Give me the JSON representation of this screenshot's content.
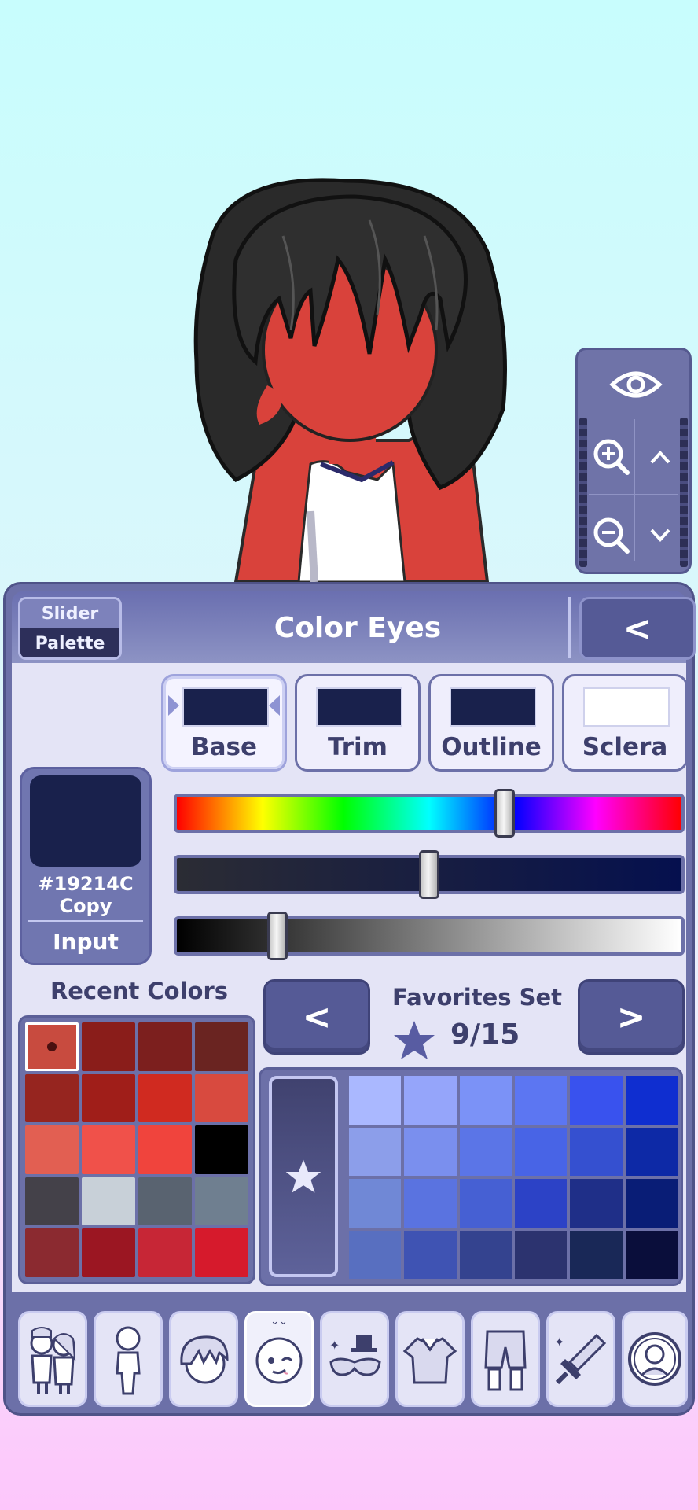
{
  "panel": {
    "title": "Color Eyes",
    "mode_toggle": {
      "slider_label": "Slider",
      "palette_label": "Palette",
      "selected": "Palette"
    },
    "back_label": "<"
  },
  "eye_parts": [
    {
      "label": "Base",
      "color": "#19214c",
      "selected": true
    },
    {
      "label": "Trim",
      "color": "#19214c",
      "selected": false
    },
    {
      "label": "Outline",
      "color": "#19214c",
      "selected": false
    },
    {
      "label": "Sclera",
      "color": "#ffffff",
      "selected": false
    }
  ],
  "current_color": {
    "hex": "#19214C",
    "copy_label": "Copy",
    "input_label": "Input"
  },
  "sliders": {
    "hue": 0.65,
    "saturation": 0.5,
    "value": 0.2
  },
  "recent_colors": {
    "title": "Recent Colors",
    "colors": [
      "#c84b3f",
      "#8a1d1a",
      "#7c1f1e",
      "#6a2421",
      "#96251f",
      "#a01e19",
      "#d02a20",
      "#d84a3f",
      "#e25f52",
      "#f0514a",
      "#f0443d",
      "#000000",
      "#444149",
      "#c8d0d8",
      "#596370",
      "#6f7f90",
      "#8b2a30",
      "#9b1622",
      "#c72636",
      "#d61a2c"
    ],
    "selected_index": 0
  },
  "favorites": {
    "title": "Favorites Set",
    "count": "9/15",
    "prev_label": "<",
    "next_label": ">",
    "colors": [
      "#aab8ff",
      "#95a5fa",
      "#7b92f7",
      "#5c76f2",
      "#3952ee",
      "#0f2ed0",
      "#8c9eea",
      "#7a8fee",
      "#5b75e7",
      "#4864e6",
      "#3550d0",
      "#0d29a6",
      "#7088d6",
      "#5a73e0",
      "#4660d3",
      "#2c42c6",
      "#1f2f88",
      "#091d76",
      "#586fc0",
      "#3f53b3",
      "#34438f",
      "#2c336f",
      "#192857",
      "#0a0e3b"
    ]
  },
  "bottom_nav": {
    "icons": [
      "characters-icon",
      "body-icon",
      "hair-icon",
      "face-icon",
      "accessories-icon",
      "top-clothing-icon",
      "bottom-clothing-icon",
      "weapons-icon",
      "profile-icon"
    ],
    "active_index": 3
  },
  "camera": {
    "icons": [
      "eye-icon",
      "zoom-in-icon",
      "move-up-icon",
      "zoom-out-icon",
      "move-down-icon"
    ]
  }
}
